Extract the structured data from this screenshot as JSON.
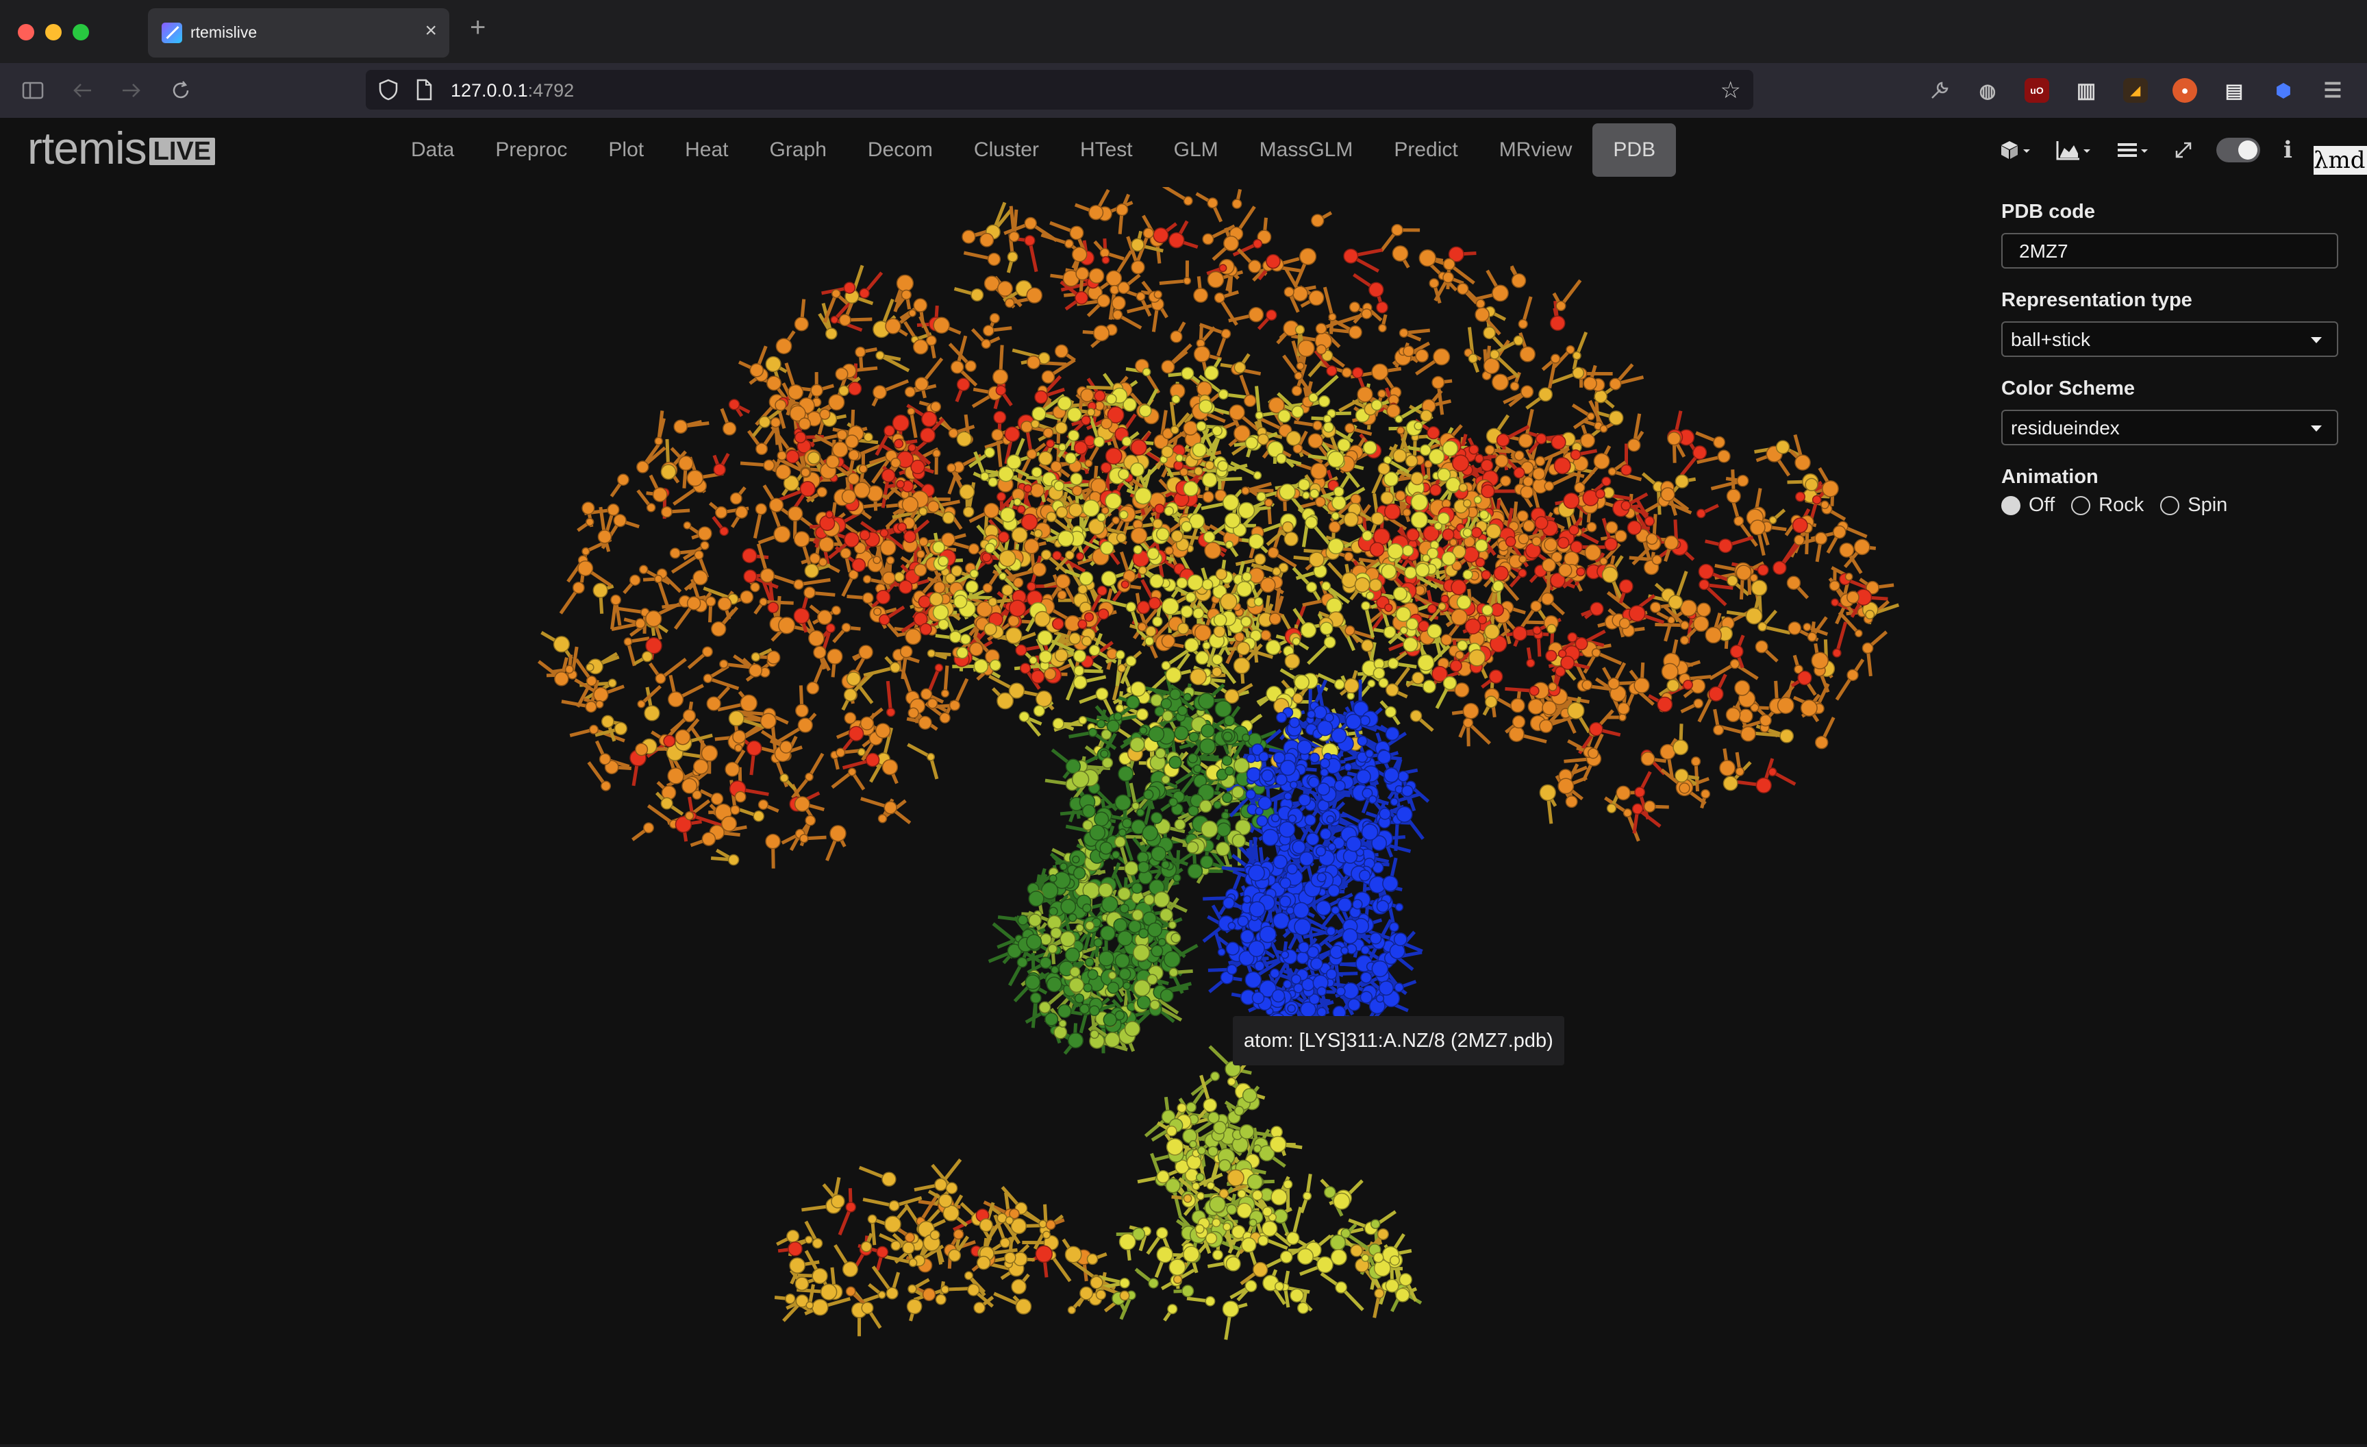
{
  "browser": {
    "tab_title": "rtemislive",
    "tab_close": "×",
    "new_tab": "+",
    "url_host": "127.0.0.1",
    "url_port": ":4792"
  },
  "app": {
    "logo_text": "rtemis",
    "logo_badge": "LIVE",
    "nav": [
      "Data",
      "Preproc",
      "Plot",
      "Heat",
      "Graph",
      "Decom",
      "Cluster",
      "HTest",
      "GLM",
      "MassGLM",
      "Predict",
      "MRview",
      "PDB"
    ],
    "active_nav": "PDB",
    "md_logo": "λmd"
  },
  "panel": {
    "pdb_code_label": "PDB code",
    "pdb_code_value": "2MZ7",
    "representation_label": "Representation type",
    "representation_value": "ball+stick",
    "color_scheme_label": "Color Scheme",
    "color_scheme_value": "residueindex",
    "animation_label": "Animation",
    "animation_options": [
      "Off",
      "Rock",
      "Spin"
    ],
    "animation_selected": "Off"
  },
  "viewer": {
    "tooltip": "atom: [LYS]311:A.NZ/8 (2MZ7.pdb)",
    "colors": {
      "red": "#e8321e",
      "orange": "#e88a25",
      "gold": "#e8b530",
      "yellow": "#e5e040",
      "lime": "#a8c83a",
      "green": "#3a8a2a",
      "blue": "#1a3cf0"
    }
  }
}
